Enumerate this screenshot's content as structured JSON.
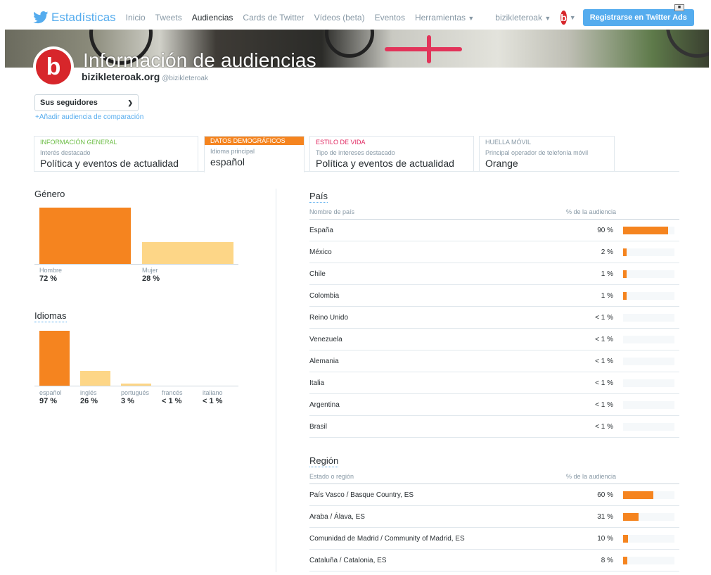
{
  "nav": {
    "brand": "Estadísticas",
    "links": [
      "Inicio",
      "Tweets",
      "Audiencias",
      "Cards de Twitter",
      "Vídeos (beta)",
      "Eventos",
      "Herramientas"
    ],
    "account": "bizikleteroak",
    "ads_button": "Registrarse en Twitter Ads",
    "avatar_letter": "b"
  },
  "header": {
    "title": "Información de audiencias",
    "profile_name": "bizikleteroak.org",
    "profile_handle": "@bizikleteroak",
    "avatar_letter": "b"
  },
  "audience": {
    "selected": "Sus seguidores",
    "add_comparison": "+Añadir audiencia de comparación"
  },
  "tabs": [
    {
      "head": "INFORMACIÓN GENERAL",
      "sub": "Interés destacado",
      "value": "Política y eventos de actualidad"
    },
    {
      "head": "DATOS DEMOGRÁFICOS",
      "sub": "Idioma principal",
      "value": "español"
    },
    {
      "head": "ESTILO DE VIDA",
      "sub": "Tipo de intereses destacado",
      "value": "Política y eventos de actualidad"
    },
    {
      "head": "HUELLA MÓVIL",
      "sub": "Principal operador de telefonía móvil",
      "value": "Orange"
    }
  ],
  "gender": {
    "title": "Género",
    "items": [
      {
        "label": "Hombre",
        "pct": "72 %",
        "value": 72
      },
      {
        "label": "Mujer",
        "pct": "28 %",
        "value": 28
      }
    ]
  },
  "languages": {
    "title": "Idiomas",
    "items": [
      {
        "label": "español",
        "pct": "97 %",
        "value": 97
      },
      {
        "label": "inglés",
        "pct": "26 %",
        "value": 26
      },
      {
        "label": "portugués",
        "pct": "3 %",
        "value": 3
      },
      {
        "label": "francés",
        "pct": "< 1 %",
        "value": 0.5
      },
      {
        "label": "italiano",
        "pct": "< 1 %",
        "value": 0.5
      }
    ]
  },
  "country": {
    "title": "País",
    "col1": "Nombre de país",
    "col2": "% de la audiencia",
    "rows": [
      {
        "name": "España",
        "pct": "90 %",
        "value": 90
      },
      {
        "name": "México",
        "pct": "2 %",
        "value": 2
      },
      {
        "name": "Chile",
        "pct": "1 %",
        "value": 1
      },
      {
        "name": "Colombia",
        "pct": "1 %",
        "value": 1
      },
      {
        "name": "Reino Unido",
        "pct": "< 1 %",
        "value": 0
      },
      {
        "name": "Venezuela",
        "pct": "< 1 %",
        "value": 0
      },
      {
        "name": "Alemania",
        "pct": "< 1 %",
        "value": 0
      },
      {
        "name": "Italia",
        "pct": "< 1 %",
        "value": 0
      },
      {
        "name": "Argentina",
        "pct": "< 1 %",
        "value": 0
      },
      {
        "name": "Brasil",
        "pct": "< 1 %",
        "value": 0
      }
    ]
  },
  "region": {
    "title": "Región",
    "col1": "Estado o región",
    "col2": "% de la audiencia",
    "rows": [
      {
        "name": "País Vasco / Basque Country, ES",
        "pct": "60 %",
        "value": 60
      },
      {
        "name": "Araba / Álava, ES",
        "pct": "31 %",
        "value": 31
      },
      {
        "name": "Comunidad de Madrid / Community of Madrid, ES",
        "pct": "10 %",
        "value": 10
      },
      {
        "name": "Cataluña / Catalonia, ES",
        "pct": "8 %",
        "value": 8
      }
    ]
  },
  "colors": {
    "accent": "#55acee",
    "primary_bar": "#f5841f",
    "secondary_bar": "#fdd687",
    "brand_red": "#d7262b"
  }
}
